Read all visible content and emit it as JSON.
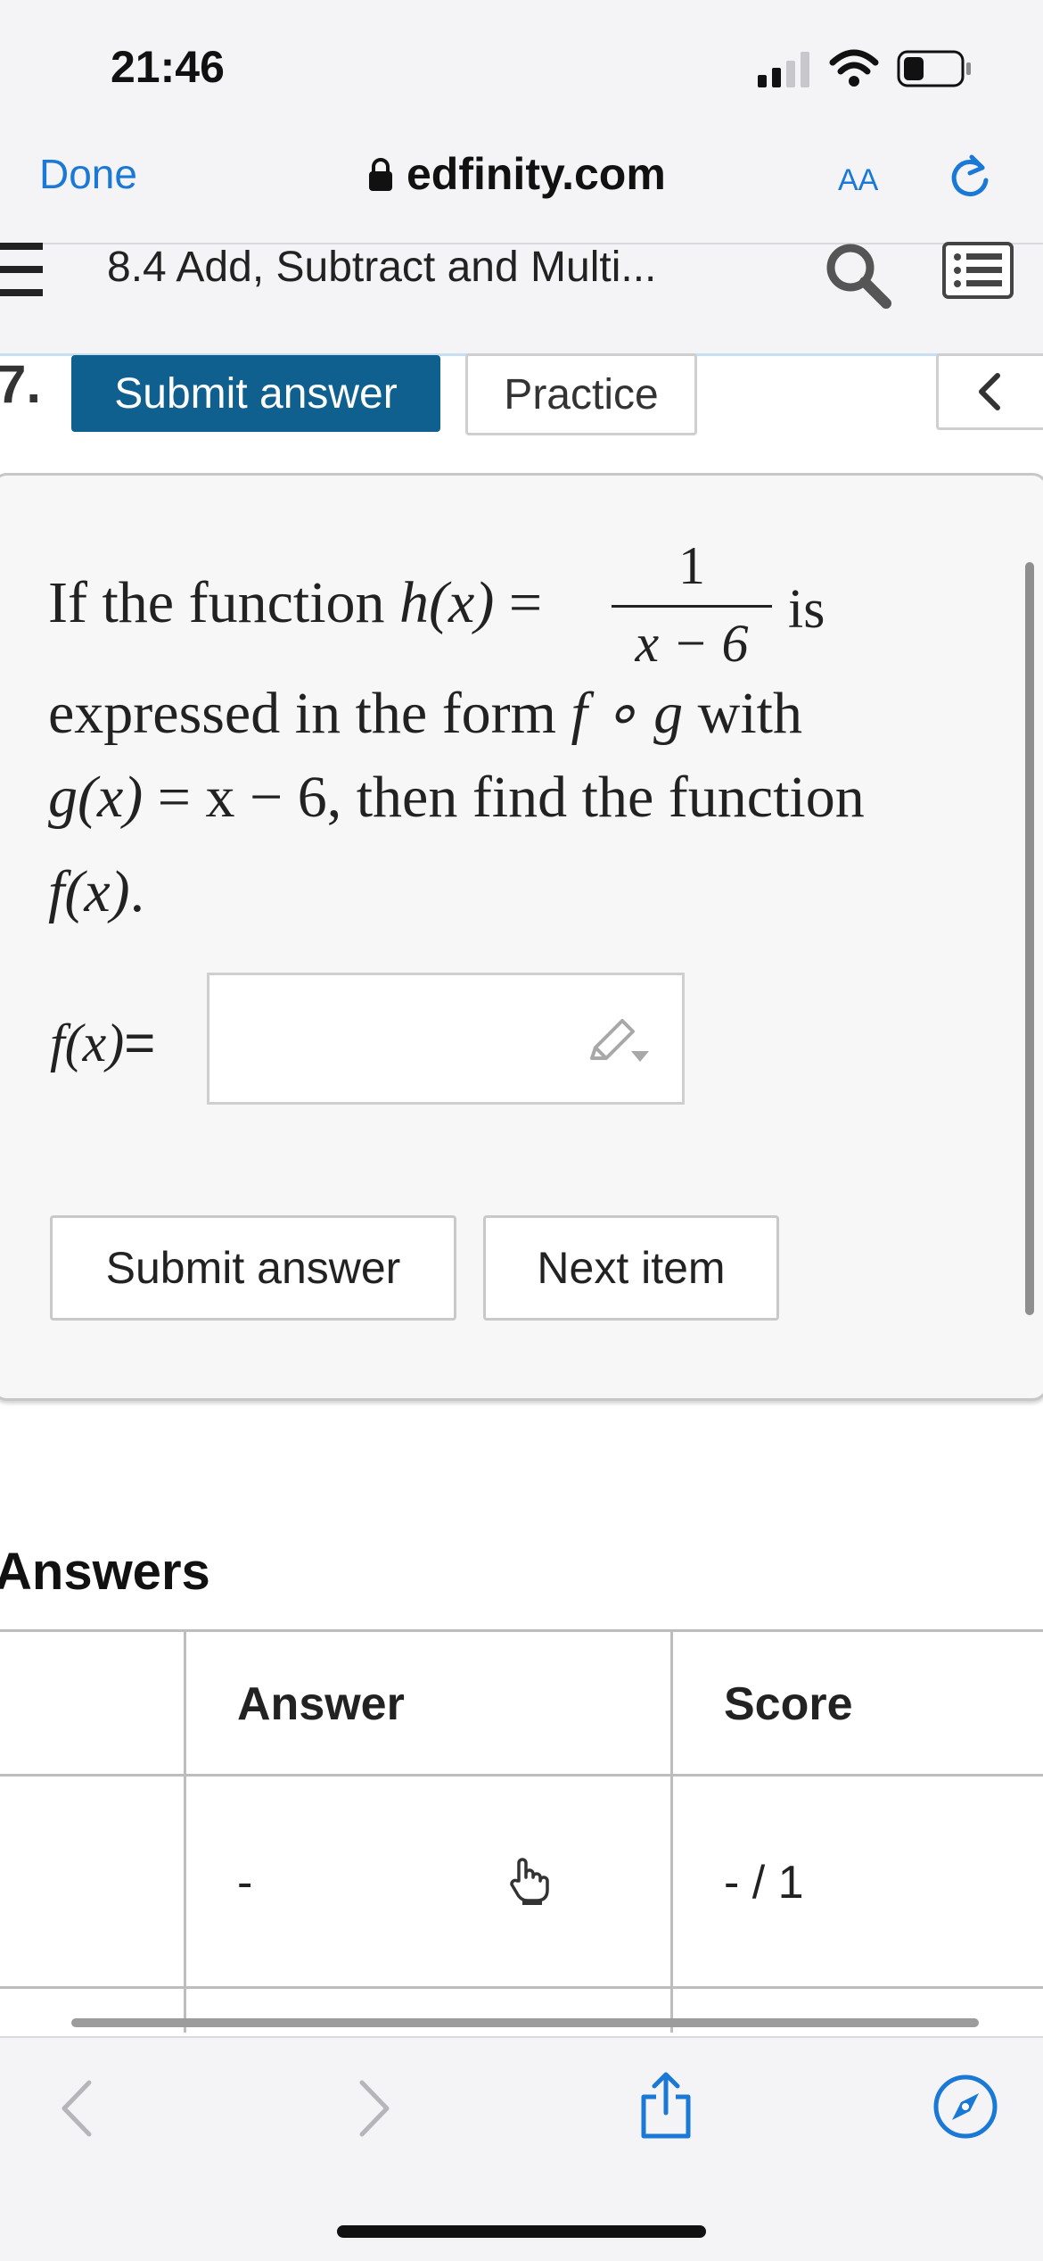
{
  "status_bar": {
    "time": "21:46"
  },
  "browser": {
    "done_label": "Done",
    "domain": "edfinity.com",
    "text_size_label": "AA"
  },
  "page_header": {
    "title": "8.4 Add, Subtract and Multi..."
  },
  "toolbar": {
    "item_number": "7.",
    "submit_label": "Submit answer",
    "practice_label": "Practice"
  },
  "question": {
    "if_text": "If the function ",
    "h_of_x": "h(x)",
    "equals": " = ",
    "frac_numerator": "1",
    "frac_denominator": "x − 6",
    "is_text": "is",
    "line2_text": "expressed in the form ",
    "composition": "f ∘ g",
    "with_text": " with",
    "g_of_x": "g(x)",
    "g_def": " = x − 6, ",
    "then_text": "then find the function",
    "f_of_x": "f(x)",
    "period": "."
  },
  "answer_field": {
    "label": "f(x)",
    "equals": "=",
    "value": ""
  },
  "actions": {
    "submit_label": "Submit answer",
    "next_label": "Next item"
  },
  "answers_table": {
    "heading": "Answers",
    "columns": [
      "Answer",
      "Score"
    ],
    "rows": [
      {
        "answer": "-",
        "score": "- / 1"
      }
    ]
  },
  "colors": {
    "accent_blue": "#1a78d6",
    "submit_bg": "#0f5f8f",
    "chrome_bg": "#f4f4f6"
  },
  "icons": [
    "lock-icon",
    "reload-icon",
    "menu-icon",
    "search-icon",
    "list-icon",
    "chevron-left-icon",
    "pencil-icon",
    "hint-hand-icon",
    "share-icon",
    "compass-icon",
    "signal-icon",
    "wifi-icon",
    "battery-icon"
  ]
}
